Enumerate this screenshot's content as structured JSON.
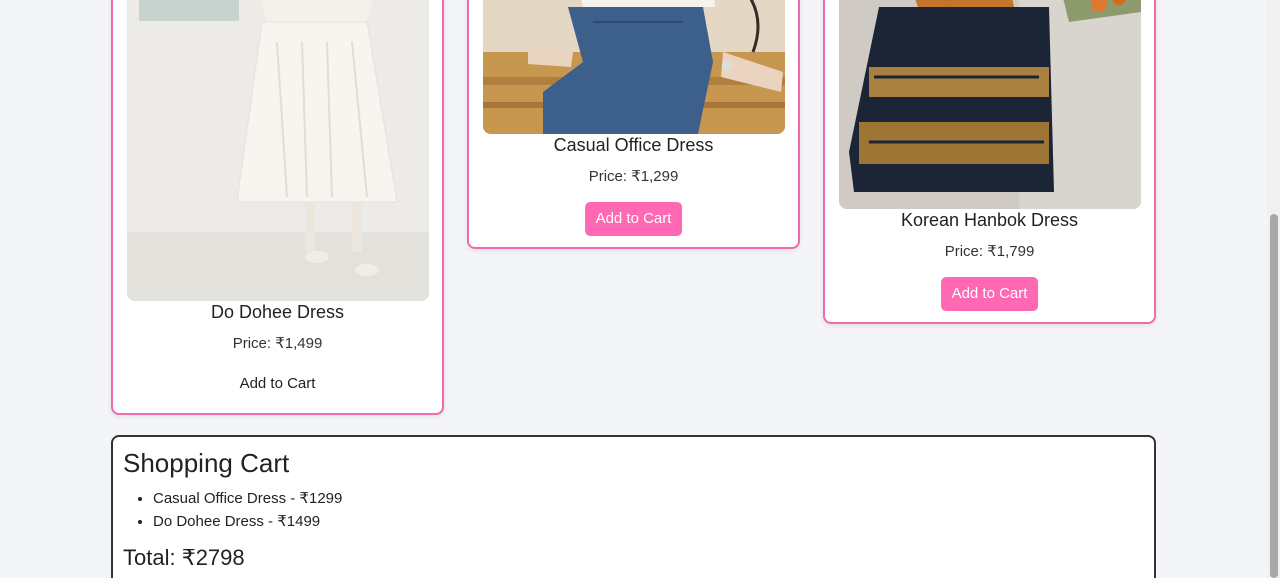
{
  "products": [
    {
      "name": "Do Dohee Dress",
      "price": "Price: ₹1,499",
      "button": "Add to Cart"
    },
    {
      "name": "Casual Office Dress",
      "price": "Price: ₹1,299",
      "button": "Add to Cart"
    },
    {
      "name": "Korean Hanbok Dress",
      "price": "Price: ₹1,799",
      "button": "Add to Cart"
    }
  ],
  "cart": {
    "title": "Shopping Cart",
    "items": [
      "Casual Office Dress - ₹1299",
      "Do Dohee Dress - ₹1499"
    ],
    "total": "Total: ₹2798"
  },
  "colors": {
    "accent": "#ff69b4",
    "card_border": "#f06aae",
    "page_bg": "#f4f5f8"
  }
}
